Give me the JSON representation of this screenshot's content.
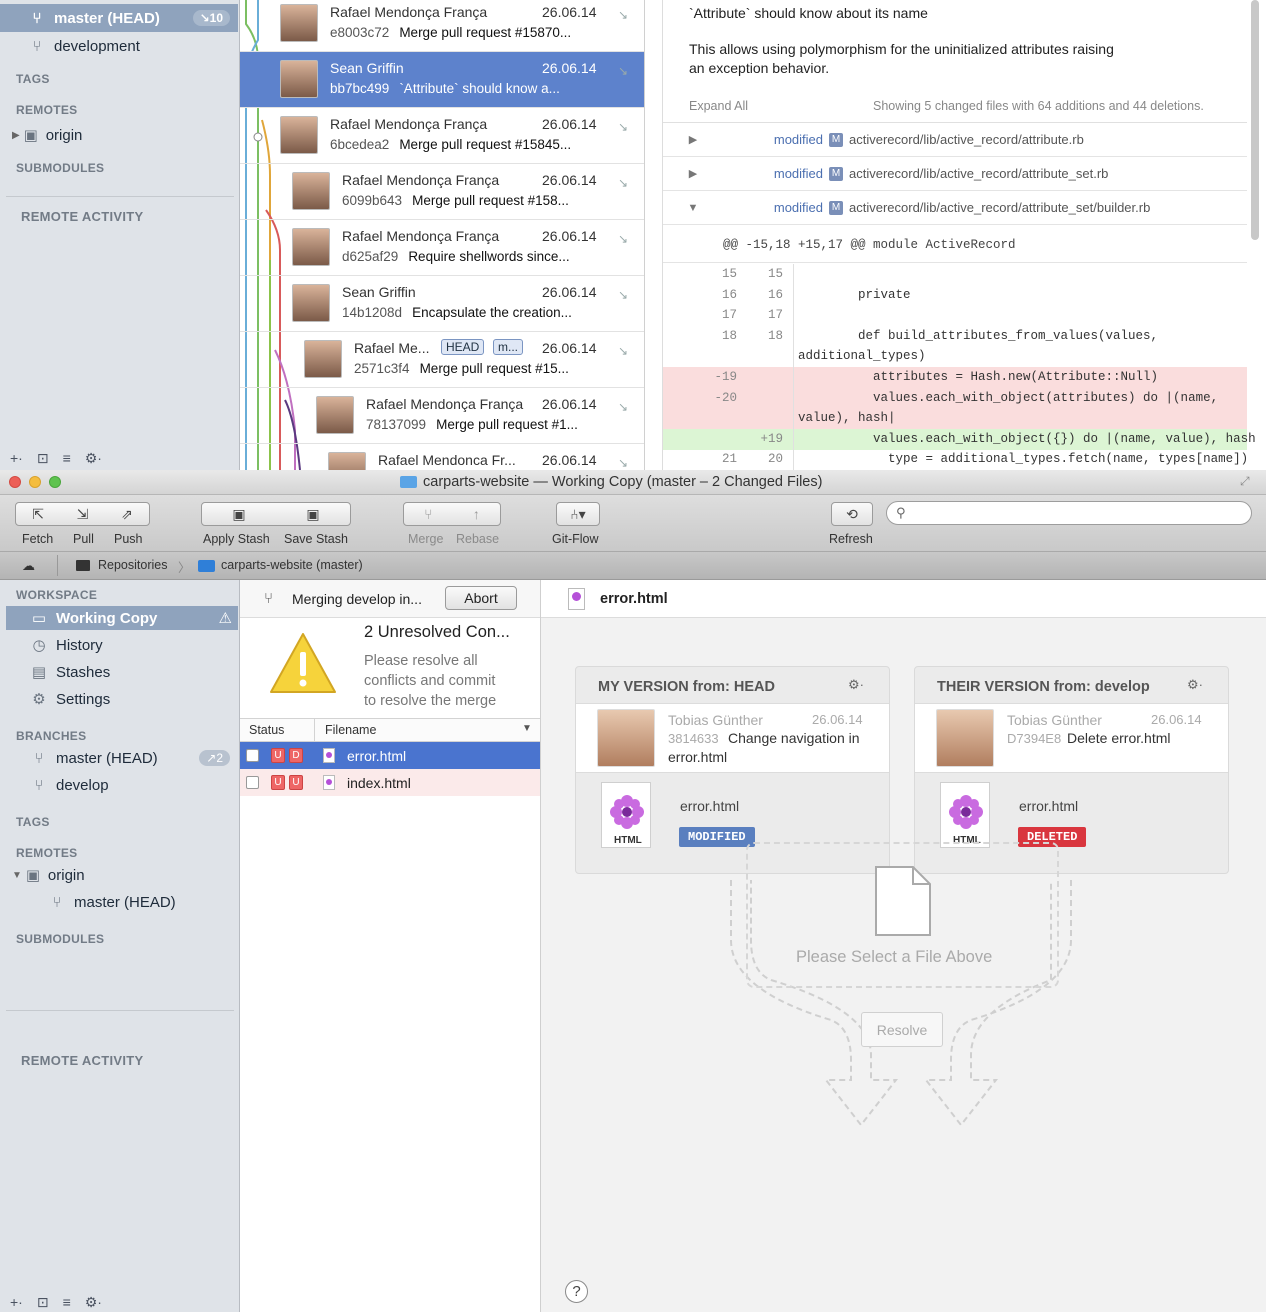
{
  "top": {
    "sidebar": {
      "branch_head": "master (HEAD)",
      "branch_head_badge": "↘10",
      "branch_dev": "development",
      "tags": "TAGS",
      "remotes": "REMOTES",
      "origin": "origin",
      "submodules": "SUBMODULES",
      "remote_activity": "REMOTE ACTIVITY"
    },
    "commits": [
      {
        "author": "Rafael Mendonça França",
        "date": "26.06.14",
        "hash": "e8003c72",
        "msg": "Merge pull request #15870..."
      },
      {
        "author": "Sean Griffin",
        "date": "26.06.14",
        "hash": "bb7bc499",
        "msg": "`Attribute` should know a..."
      },
      {
        "author": "Rafael Mendonça França",
        "date": "26.06.14",
        "hash": "6bcedea2",
        "msg": "Merge pull request #15845..."
      },
      {
        "author": "Rafael Mendonça França",
        "date": "26.06.14",
        "hash": "6099b643",
        "msg": "Merge pull request #158..."
      },
      {
        "author": "Rafael Mendonça França",
        "date": "26.06.14",
        "hash": "d625af29",
        "msg": "Require shellwords since..."
      },
      {
        "author": "Sean Griffin",
        "date": "26.06.14",
        "hash": "14b1208d",
        "msg": "Encapsulate the creation..."
      },
      {
        "author": "Rafael Me...",
        "date": "26.06.14",
        "hash": "2571c3f4",
        "msg": "Merge pull request #15...",
        "tag1": "HEAD",
        "tag2": "m..."
      },
      {
        "author": "Rafael Mendonça França",
        "date": "26.06.14",
        "hash": "78137099",
        "msg": "Merge pull request #1..."
      },
      {
        "author": "Rafael Mendonca Fr...",
        "date": "26.06.14",
        "hash": "",
        "msg": ""
      }
    ],
    "diff": {
      "line1": "`Attribute` should know about its name",
      "line2": "This allows using polymorphism for the uninitialized attributes raising",
      "line3": "an exception behavior.",
      "expand_all": "Expand All",
      "summary": "Showing 5 changed files with 64 additions and 44 deletions.",
      "files": [
        {
          "status": "modified",
          "badge": "M",
          "path": "activerecord/lib/active_record/attribute.rb",
          "tri": "▶"
        },
        {
          "status": "modified",
          "badge": "M",
          "path": "activerecord/lib/active_record/attribute_set.rb",
          "tri": "▶"
        },
        {
          "status": "modified",
          "badge": "M",
          "path": "activerecord/lib/active_record/attribute_set/builder.rb",
          "tri": "▼"
        }
      ],
      "hunk": "@@ -15,18 +15,17 @@ module ActiveRecord",
      "code": [
        {
          "old": "15",
          "new": "15",
          "text": "",
          "kind": "ctx"
        },
        {
          "old": "16",
          "new": "16",
          "text": "        private",
          "kind": "ctx"
        },
        {
          "old": "17",
          "new": "17",
          "text": "",
          "kind": "ctx"
        },
        {
          "old": "18",
          "new": "18",
          "text": "        def build_attributes_from_values(values,",
          "kind": "ctx"
        },
        {
          "old": "",
          "new": "",
          "text": "additional_types)",
          "kind": "ctx"
        },
        {
          "old": "-19",
          "new": "",
          "text": "          attributes = Hash.new(Attribute::Null)",
          "kind": "del"
        },
        {
          "old": "-20",
          "new": "",
          "text": "          values.each_with_object(attributes) do |(name,",
          "kind": "del"
        },
        {
          "old": "",
          "new": "",
          "text": "value), hash|",
          "kind": "del"
        },
        {
          "old": "",
          "new": "+19",
          "text": "          values.each_with_object({}) do |(name, value), hash",
          "kind": "add"
        },
        {
          "old": "21",
          "new": "20",
          "text": "            type = additional_types.fetch(name, types[name])",
          "kind": "ctx"
        }
      ]
    }
  },
  "window": {
    "title": "carparts-website — Working Copy (master – 2 Changed Files)",
    "toolbar": {
      "fetch": "Fetch",
      "pull": "Pull",
      "push": "Push",
      "apply_stash": "Apply Stash",
      "save_stash": "Save Stash",
      "merge": "Merge",
      "rebase": "Rebase",
      "gitflow": "Git-Flow",
      "refresh": "Refresh",
      "search_placeholder": ""
    },
    "pathbar": {
      "repos": "Repositories",
      "repo": "carparts-website (master)"
    },
    "sidebar": {
      "workspace": "WORKSPACE",
      "working_copy": "Working Copy",
      "history": "History",
      "stashes": "Stashes",
      "settings": "Settings",
      "branches": "BRANCHES",
      "master": "master (HEAD)",
      "master_badge": "↗2",
      "develop": "develop",
      "tags": "TAGS",
      "remotes": "REMOTES",
      "origin": "origin",
      "origin_master": "master (HEAD)",
      "submodules": "SUBMODULES",
      "remote_activity": "REMOTE ACTIVITY"
    },
    "merge": {
      "status": "Merging develop in...",
      "abort": "Abort",
      "heading": "2 Unresolved Con...",
      "desc1": "Please resolve all",
      "desc2": "conflicts and commit",
      "desc3": "to resolve the merge",
      "col_status": "Status",
      "col_filename": "Filename",
      "files": [
        {
          "name": "error.html",
          "s1": "U",
          "s2": "D"
        },
        {
          "name": "index.html",
          "s1": "U",
          "s2": "U"
        }
      ]
    },
    "conflict": {
      "file": "error.html",
      "mine_header": "MY VERSION from: HEAD",
      "theirs_header": "THEIR VERSION from: develop",
      "mine": {
        "author": "Tobias Günther",
        "date": "26.06.14",
        "hash": "3814633",
        "msg1": "Change navigation in",
        "msg2": "error.html",
        "filename": "error.html",
        "badge": "MODIFIED",
        "doc_label": "HTML"
      },
      "theirs": {
        "author": "Tobias Günther",
        "date": "26.06.14",
        "hash": "D7394E8",
        "msg1": "Delete error.html",
        "filename": "error.html",
        "badge": "DELETED",
        "doc_label": "HTML"
      },
      "select_prompt": "Please Select a File Above",
      "resolve": "Resolve",
      "help": "?"
    },
    "colors": {
      "selection": "#5d82cc",
      "modified": "#5a7fbf",
      "deleted": "#d9363e",
      "sidebar": "#dfe3e8"
    }
  }
}
